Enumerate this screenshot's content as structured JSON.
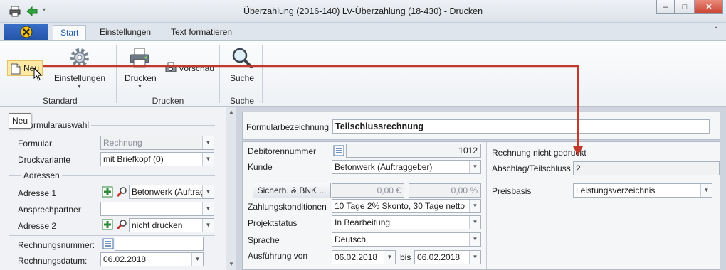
{
  "window": {
    "title": "Überzahlung (2016-140) LV-Überzahlung (18-430) - Drucken",
    "controls": {
      "minimize": "–",
      "maximize": "□",
      "close": "✕"
    }
  },
  "tabs": [
    {
      "label": "Start",
      "active": true
    },
    {
      "label": "Einstellungen",
      "active": false
    },
    {
      "label": "Text formatieren",
      "active": false
    }
  ],
  "ribbon": {
    "new_label": "Neu",
    "settings_label": "Einstellungen",
    "print_label": "Drucken",
    "preview_label": "Vorschau",
    "search_label": "Suche",
    "groups": {
      "standard": "Standard",
      "print": "Drucken",
      "search": "Suche"
    },
    "tooltip": "Neu"
  },
  "left": {
    "formular_group": "Formularauswahl",
    "formular_label": "Formular",
    "formular_value": "Rechnung",
    "druckvariante_label": "Druckvariante",
    "druckvariante_value": "mit Briefkopf (0)",
    "adressen_group": "Adressen",
    "adresse1_label": "Adresse 1",
    "adresse1_value": "Betonwerk (Auftragg",
    "ansprechpartner_label": "Ansprechpartner",
    "ansprechpartner_value": "",
    "adresse2_label": "Adresse 2",
    "adresse2_value": "nicht drucken",
    "rechnungsnummer_label": "Rechnungsnummer:",
    "rechnungsnummer_value": "",
    "rechnungsdatum_label": "Rechnungsdatum:",
    "rechnungsdatum_value": "06.02.2018"
  },
  "right": {
    "formularbezeichnung_label": "Formularbezeichnung",
    "formularbezeichnung_value": "Teilschlussrechnung",
    "debitorennummer_label": "Debitorennummer",
    "debitorennummer_value": "1012",
    "kunde_label": "Kunde",
    "kunde_value": "Betonwerk (Auftraggeber)",
    "sicherh_button": "Sicherh. & BNK ...",
    "amount_value": "0,00 €",
    "percent_value": "0,00 %",
    "zahlung_label": "Zahlungskonditionen",
    "zahlung_value": "10 Tage 2% Skonto, 30 Tage netto",
    "projektstatus_label": "Projektstatus",
    "projektstatus_value": "In Bearbeitung",
    "sprache_label": "Sprache",
    "sprache_value": "Deutsch",
    "ausfuehrung_label": "Ausführung von",
    "ausfuehrung_from": "06.02.2018",
    "bis_label": "bis",
    "ausfuehrung_to": "06.02.2018",
    "nicht_gedruckt_label": "Rechnung nicht gedruckt",
    "abschlag_label": "Abschlag/Teilschluss Nr",
    "abschlag_value": "2",
    "preisbasis_label": "Preisbasis",
    "preisbasis_value": "Leistungsverzeichnis"
  },
  "colors": {
    "accent": "#1f5dab",
    "arrow": "#c0392b",
    "app_button": "#2a5db0"
  }
}
